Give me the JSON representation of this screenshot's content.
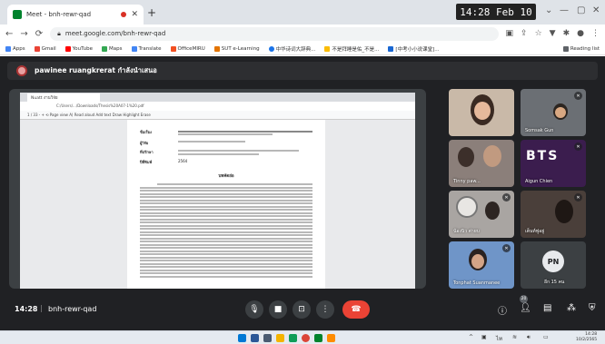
{
  "browser": {
    "tab_title": "Meet - bnh-rewr-qad",
    "url": "meet.google.com/bnh-rewr-qad",
    "clock_overlay": "14:28  Feb 10",
    "bookmarks": [
      "Apps",
      "Gmail",
      "YouTube",
      "Maps",
      "Translate",
      "OfficeMIRU",
      "SUT e-Learning",
      "中华诗词大辞典...",
      "不是拜睡是佑_不是...",
      "[中考小小说课堂]...",
      "Reading list"
    ]
  },
  "meet": {
    "presenter_label": "pawinee ruangkrerat กำลังนำเสนอ",
    "meeting_time": "14:28",
    "meeting_code": "bnh-rewr-qad",
    "people_count": "20"
  },
  "shared_doc": {
    "inner_tab": "Nuatt  งานวิจัย",
    "inner_url": "C:/Users/.../Downloads/Thesis%20A07-1%20.pdf",
    "toolbar_text": "1 / 33   -  +   ⟲   Page view   A) Read aloud   Add text   Draw   Highlight   Erase",
    "meta_labels": [
      "ชื่อเรื่อง",
      "ผู้วิจัย",
      "ที่ปรึกษา",
      "ปีที่พิมพ์"
    ],
    "year_value": "2564",
    "abstract_heading": "บทคัดย่อ"
  },
  "participants": [
    {
      "name": "",
      "type": "video-woman"
    },
    {
      "name": "Somsak Gun",
      "type": "video-man"
    },
    {
      "name": "Tinny paw...",
      "type": "video-group"
    },
    {
      "name": "Aigun Chien",
      "type": "bts"
    },
    {
      "name": "น้องนิว ต่ายบ",
      "type": "video-fan"
    },
    {
      "name": "เต็นท์ฟูอยู่",
      "type": "video-dark"
    },
    {
      "name": "Tonphat Suanmanee",
      "type": "video-blue"
    },
    {
      "name": "อีก 15 คน",
      "type": "more",
      "initials": "PN"
    }
  ],
  "taskbar": {
    "time": "14:28",
    "date": "10/2/2565"
  },
  "colors": {
    "meet_bg": "#202124",
    "end_call": "#ea4335",
    "tile_bg": "#3c4043"
  }
}
